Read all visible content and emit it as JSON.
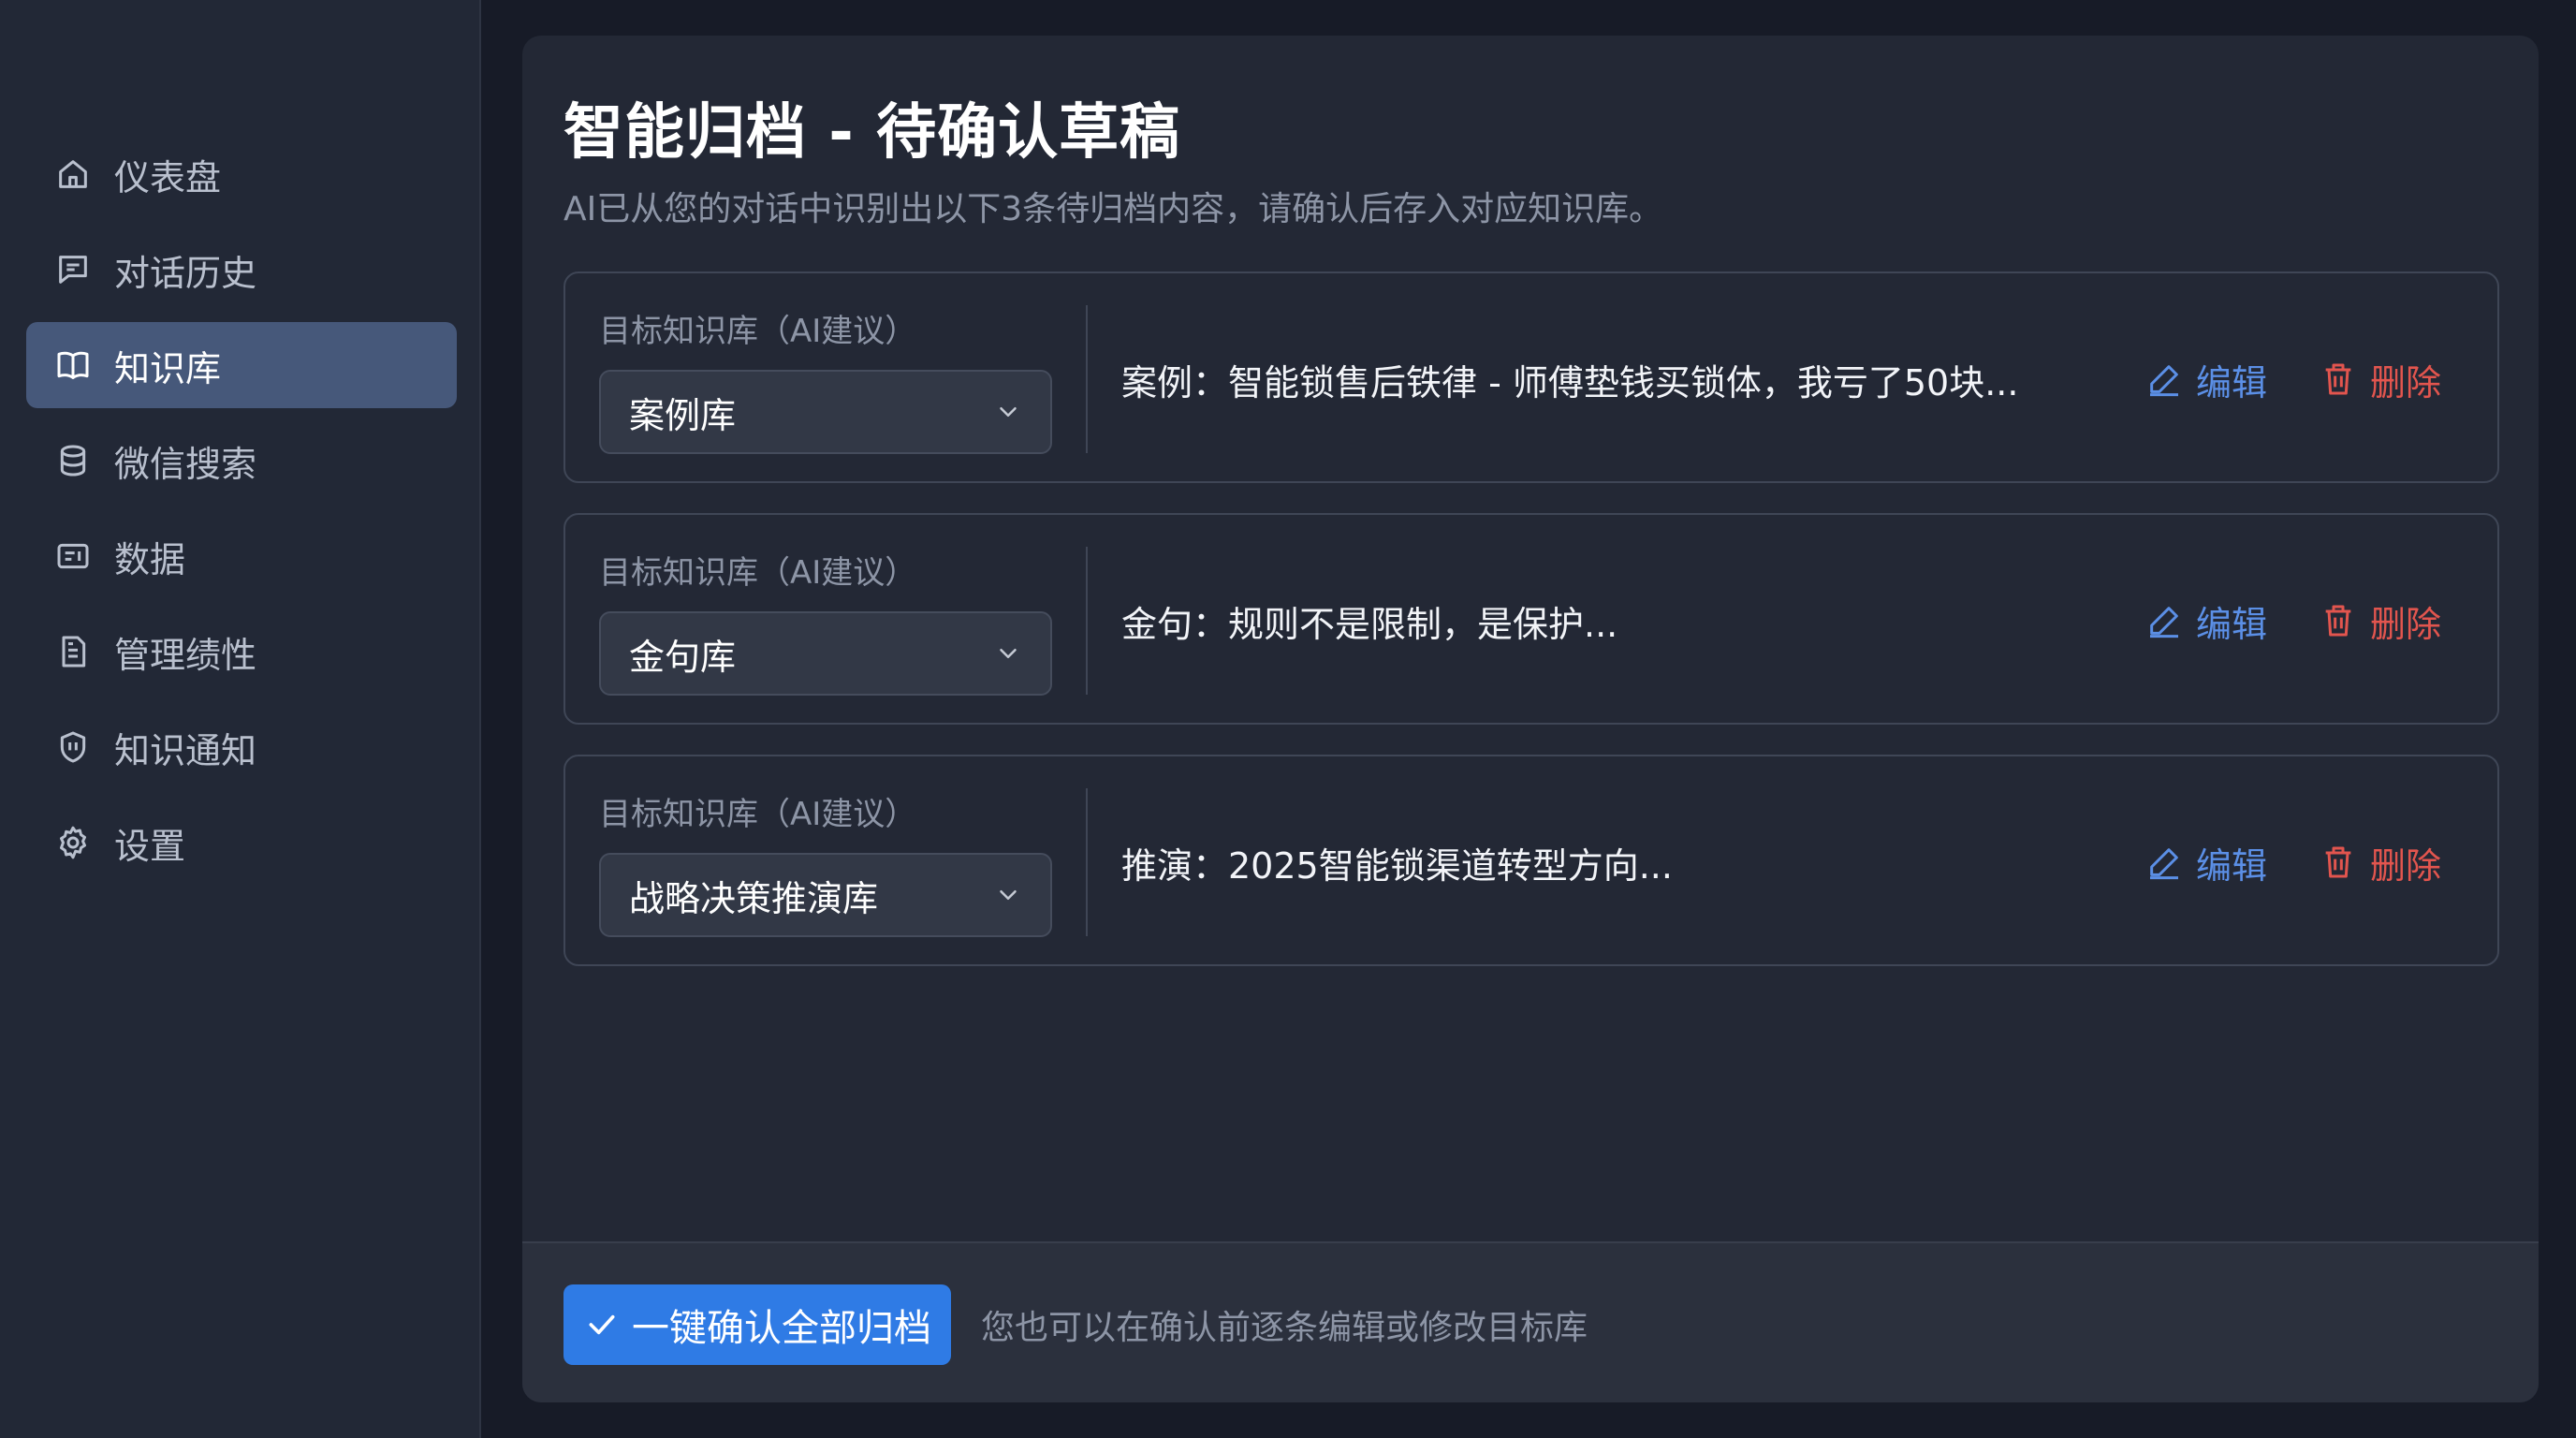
{
  "sidebar": {
    "items": [
      {
        "label": "仪表盘",
        "icon": "home-icon",
        "active": false
      },
      {
        "label": "对话历史",
        "icon": "chat-icon",
        "active": false
      },
      {
        "label": "知识库",
        "icon": "book-icon",
        "active": true
      },
      {
        "label": "微信搜索",
        "icon": "database-icon",
        "active": false
      },
      {
        "label": "数据",
        "icon": "screen-icon",
        "active": false
      },
      {
        "label": "管理绩性",
        "icon": "document-icon",
        "active": false
      },
      {
        "label": "知识通知",
        "icon": "shield-icon",
        "active": false
      },
      {
        "label": "设置",
        "icon": "gear-icon",
        "active": false
      }
    ]
  },
  "main": {
    "title": "智能归档 - 待确认草稿",
    "subtitle": "AI已从您的对话中识别出以下3条待归档内容，请确认后存入对应知识库。",
    "cards": [
      {
        "field_label": "目标知识库（AI建议）",
        "selected": "案例库",
        "content": "案例：智能锁售后铁律 - 师傅垫钱买锁体，我亏了50块...",
        "edit_label": "编辑",
        "delete_label": "删除"
      },
      {
        "field_label": "目标知识库（AI建议）",
        "selected": "金句库",
        "content": "金句：规则不是限制，是保护...",
        "edit_label": "编辑",
        "delete_label": "删除"
      },
      {
        "field_label": "目标知识库（AI建议）",
        "selected": "战略决策推演库",
        "content": "推演：2025智能锁渠道转型方向...",
        "edit_label": "编辑",
        "delete_label": "删除"
      }
    ]
  },
  "footer": {
    "confirm_label": "一键确认全部归档",
    "hint": "您也可以在确认前逐条编辑或修改目标库"
  },
  "colors": {
    "accent": "#2f7be5",
    "edit": "#5b8fe6",
    "delete": "#e2554e",
    "active_nav": "#46587a"
  }
}
